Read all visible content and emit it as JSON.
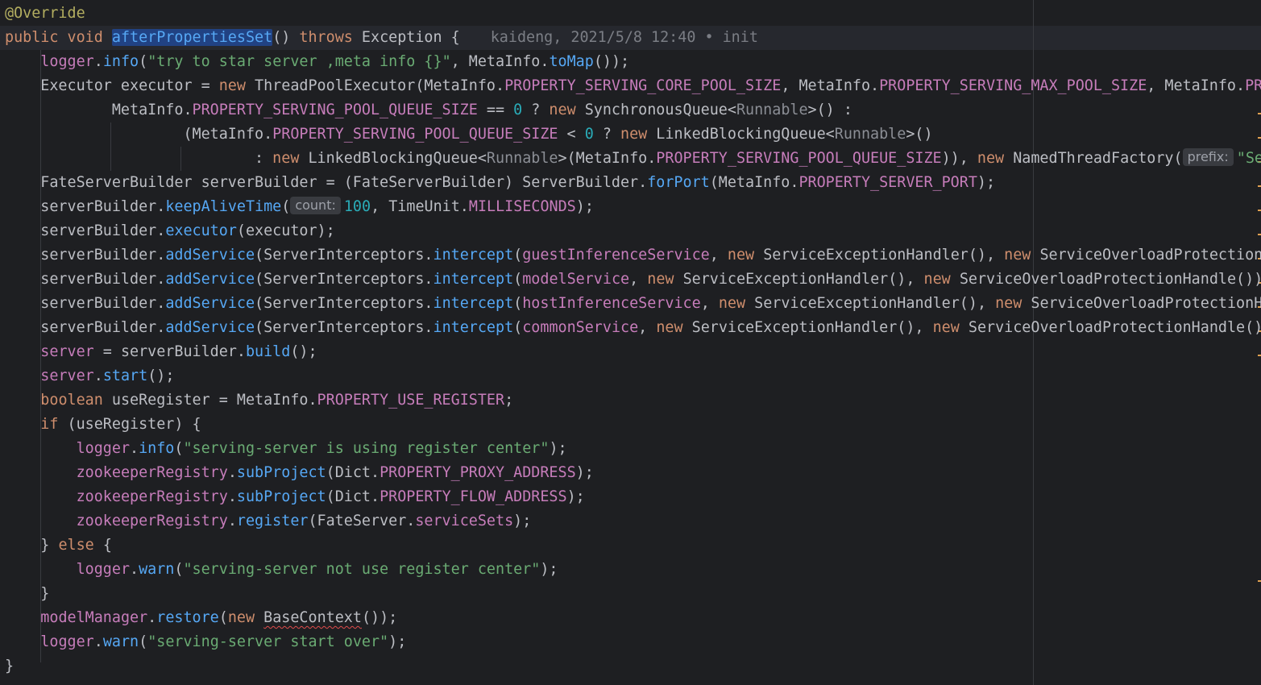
{
  "colors": {
    "background": "#1e1f22",
    "keyword": "#cf8e6d",
    "default_text": "#bcbec4",
    "method": "#56a8f5",
    "field": "#c77dbb",
    "string": "#6aab73",
    "number": "#2aacb8",
    "annotation": "#b3ae60",
    "type_param": "#16baac",
    "error_marker": "#e0a050"
  },
  "code_lines": [
    {
      "tokens": [
        {
          "t": "@Override",
          "c": "#b3ae60"
        }
      ]
    },
    {
      "tokens": [
        {
          "t": "public void ",
          "c": "#cf8e6d"
        },
        {
          "t": "afterPropertiesSet",
          "c": "#56a8f5",
          "cls": "sel-word"
        },
        {
          "t": "() ",
          "c": "#bcbec4"
        },
        {
          "t": "throws ",
          "c": "#cf8e6d"
        },
        {
          "t": "Exception ",
          "c": "#bcbec4"
        },
        {
          "t": "{",
          "c": "#bcbec4"
        }
      ],
      "blame": "kaideng, 2021/5/8 12:40 • init"
    },
    {
      "tokens": [
        {
          "t": "    "
        },
        {
          "t": "logger",
          "c": "#c77dbb"
        },
        {
          "t": "."
        },
        {
          "t": "info",
          "c": "#56a8f5"
        },
        {
          "t": "("
        },
        {
          "t": "\"try to star server ,meta info {}\"",
          "c": "#6aab73"
        },
        {
          "t": ", MetaInfo."
        },
        {
          "t": "toMap",
          "c": "#56a8f5"
        },
        {
          "t": "());"
        }
      ]
    },
    {
      "tokens": [
        {
          "t": "    Executor executor = "
        },
        {
          "t": "new ",
          "c": "#cf8e6d"
        },
        {
          "t": "ThreadPoolExecutor(MetaInfo."
        },
        {
          "t": "PROPERTY_SERVING_CORE_POOL_SIZE",
          "c": "#c77dbb"
        },
        {
          "t": ", MetaInfo."
        },
        {
          "t": "PROPERTY_SERVING_MAX_POOL_SIZE",
          "c": "#c77dbb"
        },
        {
          "t": ", MetaInfo."
        },
        {
          "t": "PRO",
          "c": "#c77dbb"
        }
      ]
    },
    {
      "tokens": [
        {
          "t": "            MetaInfo."
        },
        {
          "t": "PROPERTY_SERVING_POOL_QUEUE_SIZE",
          "c": "#c77dbb"
        },
        {
          "t": " == "
        },
        {
          "t": "0",
          "c": "#2aacb8"
        },
        {
          "t": " ? "
        },
        {
          "t": "new ",
          "c": "#cf8e6d"
        },
        {
          "t": "SynchronousQueue<"
        },
        {
          "t": "Runnable",
          "c": "#8b8e95"
        },
        {
          "t": ">() :"
        }
      ]
    },
    {
      "tokens": [
        {
          "t": "                    (MetaInfo."
        },
        {
          "t": "PROPERTY_SERVING_POOL_QUEUE_SIZE",
          "c": "#c77dbb"
        },
        {
          "t": " < "
        },
        {
          "t": "0",
          "c": "#2aacb8"
        },
        {
          "t": " ? "
        },
        {
          "t": "new ",
          "c": "#cf8e6d"
        },
        {
          "t": "LinkedBlockingQueue<"
        },
        {
          "t": "Runnable",
          "c": "#8b8e95"
        },
        {
          "t": ">()"
        }
      ]
    },
    {
      "tokens": [
        {
          "t": "                            : "
        },
        {
          "t": "new ",
          "c": "#cf8e6d"
        },
        {
          "t": "LinkedBlockingQueue<"
        },
        {
          "t": "Runnable",
          "c": "#8b8e95"
        },
        {
          "t": ">(MetaInfo."
        },
        {
          "t": "PROPERTY_SERVING_POOL_QUEUE_SIZE",
          "c": "#c77dbb"
        },
        {
          "t": ")), "
        },
        {
          "t": "new ",
          "c": "#cf8e6d"
        },
        {
          "t": "NamedThreadFactory("
        },
        {
          "hint": "prefix:"
        },
        {
          "t": "\"Ser",
          "c": "#6aab73"
        }
      ]
    },
    {
      "tokens": [
        {
          "t": "    FateServerBuilder serverBuilder = (FateServerBuilder) ServerBuilder."
        },
        {
          "t": "forPort",
          "c": "#56a8f5"
        },
        {
          "t": "(MetaInfo."
        },
        {
          "t": "PROPERTY_SERVER_PORT",
          "c": "#c77dbb"
        },
        {
          "t": ");"
        }
      ]
    },
    {
      "tokens": [
        {
          "t": "    serverBuilder."
        },
        {
          "t": "keepAliveTime",
          "c": "#56a8f5"
        },
        {
          "t": "("
        },
        {
          "hint": "count:"
        },
        {
          "t": "100",
          "c": "#2aacb8"
        },
        {
          "t": ", TimeUnit."
        },
        {
          "t": "MILLISECONDS",
          "c": "#c77dbb"
        },
        {
          "t": ");"
        }
      ]
    },
    {
      "tokens": [
        {
          "t": "    serverBuilder."
        },
        {
          "t": "executor",
          "c": "#56a8f5"
        },
        {
          "t": "(executor);"
        }
      ]
    },
    {
      "tokens": [
        {
          "t": "    serverBuilder."
        },
        {
          "t": "addService",
          "c": "#56a8f5"
        },
        {
          "t": "(ServerInterceptors."
        },
        {
          "t": "intercept",
          "c": "#56a8f5"
        },
        {
          "t": "("
        },
        {
          "t": "guestInferenceService",
          "c": "#c77dbb"
        },
        {
          "t": ", "
        },
        {
          "t": "new ",
          "c": "#cf8e6d"
        },
        {
          "t": "ServiceExceptionHandler(), "
        },
        {
          "t": "new ",
          "c": "#cf8e6d"
        },
        {
          "t": "ServiceOverloadProtectionH"
        }
      ]
    },
    {
      "tokens": [
        {
          "t": "    serverBuilder."
        },
        {
          "t": "addService",
          "c": "#56a8f5"
        },
        {
          "t": "(ServerInterceptors."
        },
        {
          "t": "intercept",
          "c": "#56a8f5"
        },
        {
          "t": "("
        },
        {
          "t": "modelService",
          "c": "#c77dbb"
        },
        {
          "t": ", "
        },
        {
          "t": "new ",
          "c": "#cf8e6d"
        },
        {
          "t": "ServiceExceptionHandler(), "
        },
        {
          "t": "new ",
          "c": "#cf8e6d"
        },
        {
          "t": "ServiceOverloadProtectionHandle()),"
        }
      ]
    },
    {
      "tokens": [
        {
          "t": "    serverBuilder."
        },
        {
          "t": "addService",
          "c": "#56a8f5"
        },
        {
          "t": "(ServerInterceptors."
        },
        {
          "t": "intercept",
          "c": "#56a8f5"
        },
        {
          "t": "("
        },
        {
          "t": "hostInferenceService",
          "c": "#c77dbb"
        },
        {
          "t": ", "
        },
        {
          "t": "new ",
          "c": "#cf8e6d"
        },
        {
          "t": "ServiceExceptionHandler(), "
        },
        {
          "t": "new ",
          "c": "#cf8e6d"
        },
        {
          "t": "ServiceOverloadProtectionHa"
        }
      ]
    },
    {
      "tokens": [
        {
          "t": "    serverBuilder."
        },
        {
          "t": "addService",
          "c": "#56a8f5"
        },
        {
          "t": "(ServerInterceptors."
        },
        {
          "t": "intercept",
          "c": "#56a8f5"
        },
        {
          "t": "("
        },
        {
          "t": "commonService",
          "c": "#c77dbb"
        },
        {
          "t": ", "
        },
        {
          "t": "new ",
          "c": "#cf8e6d"
        },
        {
          "t": "ServiceExceptionHandler(), "
        },
        {
          "t": "new ",
          "c": "#cf8e6d"
        },
        {
          "t": "ServiceOverloadProtectionHandle())"
        }
      ]
    },
    {
      "tokens": [
        {
          "t": "    "
        },
        {
          "t": "server",
          "c": "#c77dbb"
        },
        {
          "t": " = serverBuilder."
        },
        {
          "t": "build",
          "c": "#56a8f5"
        },
        {
          "t": "();"
        }
      ]
    },
    {
      "tokens": [
        {
          "t": "    "
        },
        {
          "t": "server",
          "c": "#c77dbb"
        },
        {
          "t": "."
        },
        {
          "t": "start",
          "c": "#56a8f5"
        },
        {
          "t": "();"
        }
      ]
    },
    {
      "tokens": [
        {
          "t": "    "
        },
        {
          "t": "boolean ",
          "c": "#cf8e6d"
        },
        {
          "t": "useRegister = MetaInfo."
        },
        {
          "t": "PROPERTY_USE_REGISTER",
          "c": "#c77dbb"
        },
        {
          "t": ";"
        }
      ]
    },
    {
      "tokens": [
        {
          "t": "    "
        },
        {
          "t": "if ",
          "c": "#cf8e6d"
        },
        {
          "t": "(useRegister) {"
        }
      ]
    },
    {
      "tokens": [
        {
          "t": "        "
        },
        {
          "t": "logger",
          "c": "#c77dbb"
        },
        {
          "t": "."
        },
        {
          "t": "info",
          "c": "#56a8f5"
        },
        {
          "t": "("
        },
        {
          "t": "\"serving-server is using register center\"",
          "c": "#6aab73"
        },
        {
          "t": ");"
        }
      ]
    },
    {
      "tokens": [
        {
          "t": "        "
        },
        {
          "t": "zookeeperRegistry",
          "c": "#c77dbb"
        },
        {
          "t": "."
        },
        {
          "t": "subProject",
          "c": "#56a8f5"
        },
        {
          "t": "(Dict."
        },
        {
          "t": "PROPERTY_PROXY_ADDRESS",
          "c": "#c77dbb"
        },
        {
          "t": ");"
        }
      ]
    },
    {
      "tokens": [
        {
          "t": "        "
        },
        {
          "t": "zookeeperRegistry",
          "c": "#c77dbb"
        },
        {
          "t": "."
        },
        {
          "t": "subProject",
          "c": "#56a8f5"
        },
        {
          "t": "(Dict."
        },
        {
          "t": "PROPERTY_FLOW_ADDRESS",
          "c": "#c77dbb"
        },
        {
          "t": ");"
        }
      ]
    },
    {
      "tokens": [
        {
          "t": "        "
        },
        {
          "t": "zookeeperRegistry",
          "c": "#c77dbb"
        },
        {
          "t": "."
        },
        {
          "t": "register",
          "c": "#56a8f5"
        },
        {
          "t": "(FateServer."
        },
        {
          "t": "serviceSets",
          "c": "#c77dbb"
        },
        {
          "t": ");"
        }
      ]
    },
    {
      "tokens": [
        {
          "t": "    } "
        },
        {
          "t": "else ",
          "c": "#cf8e6d"
        },
        {
          "t": "{"
        }
      ]
    },
    {
      "tokens": [
        {
          "t": "        "
        },
        {
          "t": "logger",
          "c": "#c77dbb"
        },
        {
          "t": "."
        },
        {
          "t": "warn",
          "c": "#56a8f5"
        },
        {
          "t": "("
        },
        {
          "t": "\"serving-server not use register center\"",
          "c": "#6aab73"
        },
        {
          "t": ");"
        }
      ]
    },
    {
      "tokens": [
        {
          "t": "    }"
        }
      ]
    },
    {
      "tokens": [
        {
          "t": "    "
        },
        {
          "t": "modelManager",
          "c": "#c77dbb"
        },
        {
          "t": "."
        },
        {
          "t": "restore",
          "c": "#56a8f5"
        },
        {
          "t": "("
        },
        {
          "t": "new ",
          "c": "#cf8e6d"
        },
        {
          "t": "BaseContext",
          "cls": "squiggle"
        },
        {
          "t": "());"
        }
      ]
    },
    {
      "tokens": [
        {
          "t": "    "
        },
        {
          "t": "logger",
          "c": "#c77dbb"
        },
        {
          "t": "."
        },
        {
          "t": "warn",
          "c": "#56a8f5"
        },
        {
          "t": "("
        },
        {
          "t": "\"serving-server start over\"",
          "c": "#6aab73"
        },
        {
          "t": ");"
        }
      ]
    },
    {
      "tokens": [
        {
          "t": "}"
        }
      ]
    }
  ]
}
